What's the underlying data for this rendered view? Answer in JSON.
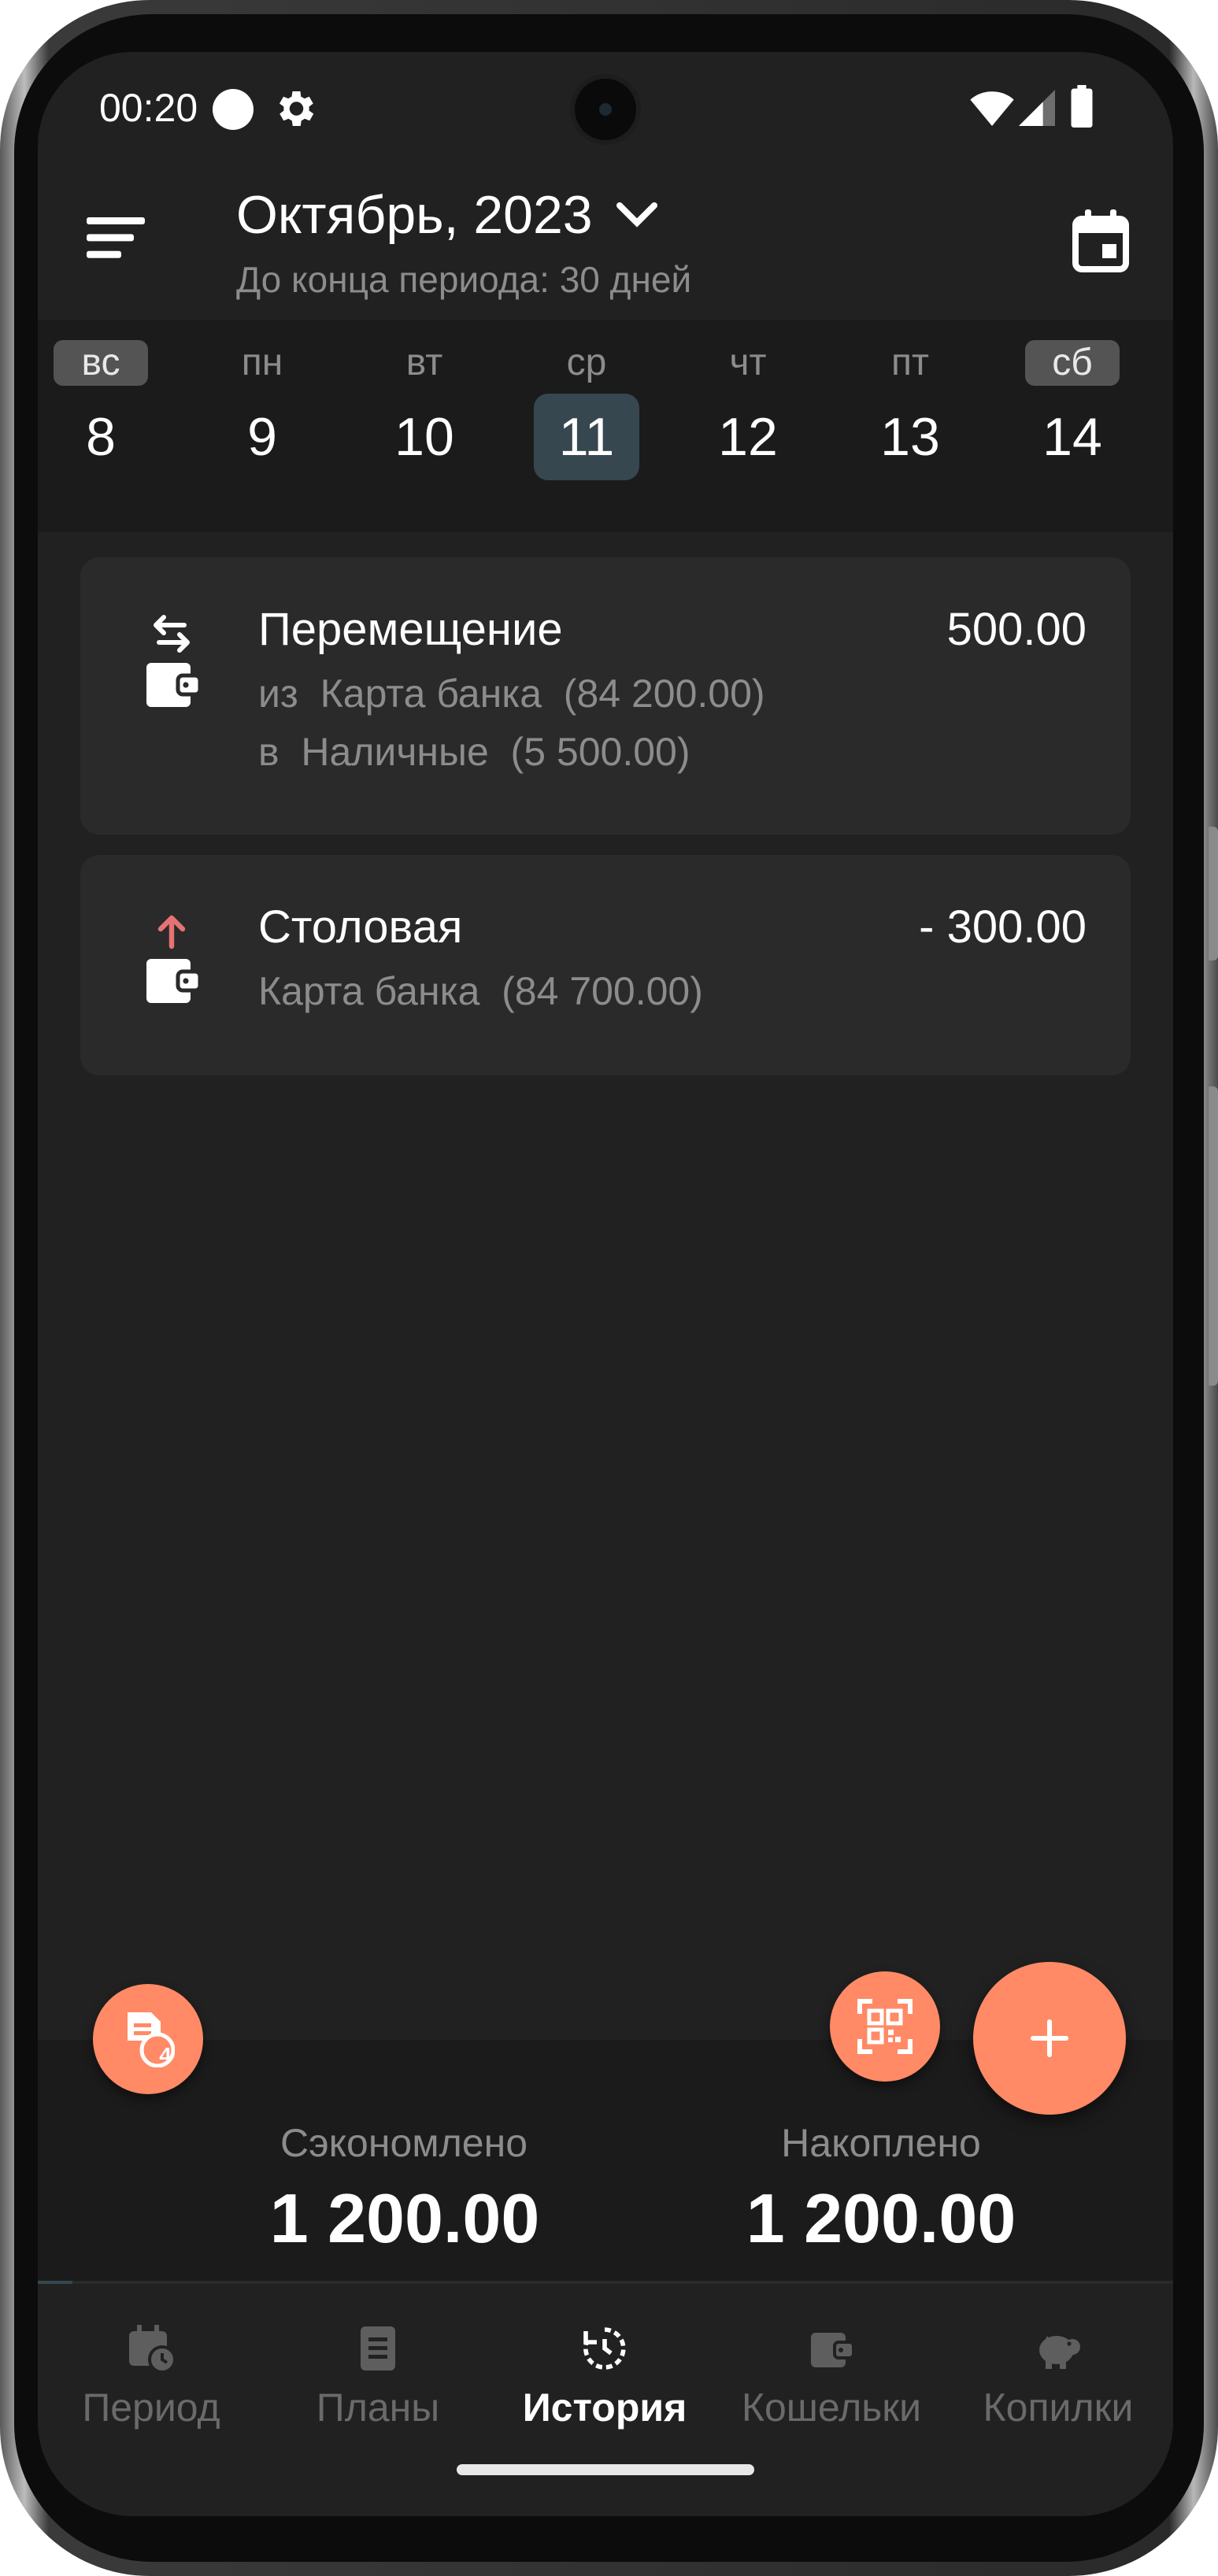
{
  "status_bar": {
    "time": "00:20"
  },
  "header": {
    "month_title": "Октябрь, 2023",
    "subtitle": "До конца периода: 30 дней"
  },
  "week": [
    {
      "name": "вс",
      "num": "8",
      "weekend": true,
      "selected": false
    },
    {
      "name": "пн",
      "num": "9",
      "weekend": false,
      "selected": false
    },
    {
      "name": "вт",
      "num": "10",
      "weekend": false,
      "selected": false
    },
    {
      "name": "ср",
      "num": "11",
      "weekend": false,
      "selected": true
    },
    {
      "name": "чт",
      "num": "12",
      "weekend": false,
      "selected": false
    },
    {
      "name": "пт",
      "num": "13",
      "weekend": false,
      "selected": false
    },
    {
      "name": "сб",
      "num": "14",
      "weekend": true,
      "selected": false
    }
  ],
  "transactions": [
    {
      "icon": "wallet-transfer-icon",
      "title": "Перемещение",
      "amount": "500.00",
      "line1": "из  Карта банка  (84 200.00)",
      "line2": "в  Наличные  (5 500.00)"
    },
    {
      "icon": "wallet-expense-icon",
      "title": "Столовая",
      "amount": "- 300.00",
      "line1": "Карта банка  (84 700.00)"
    }
  ],
  "fabs": {
    "notes_badge": "4"
  },
  "summary": {
    "saved_label": "Сэкономлено",
    "saved_value": "1 200.00",
    "accumulated_label": "Накоплено",
    "accumulated_value": "1 200.00"
  },
  "tabs": [
    {
      "label": "Период",
      "icon": "calendar-clock-icon",
      "active": false
    },
    {
      "label": "Планы",
      "icon": "document-icon",
      "active": false
    },
    {
      "label": "История",
      "icon": "history-icon",
      "active": true
    },
    {
      "label": "Кошельки",
      "icon": "wallet-icon",
      "active": false
    },
    {
      "label": "Копилки",
      "icon": "piggy-bank-icon",
      "active": false
    }
  ],
  "colors": {
    "background": "#212121",
    "card": "#2a2a2a",
    "accent": "#ff8a65",
    "selected_day": "#37474f",
    "expense_arrow": "#e57373",
    "muted_text": "#8c8c8c"
  }
}
